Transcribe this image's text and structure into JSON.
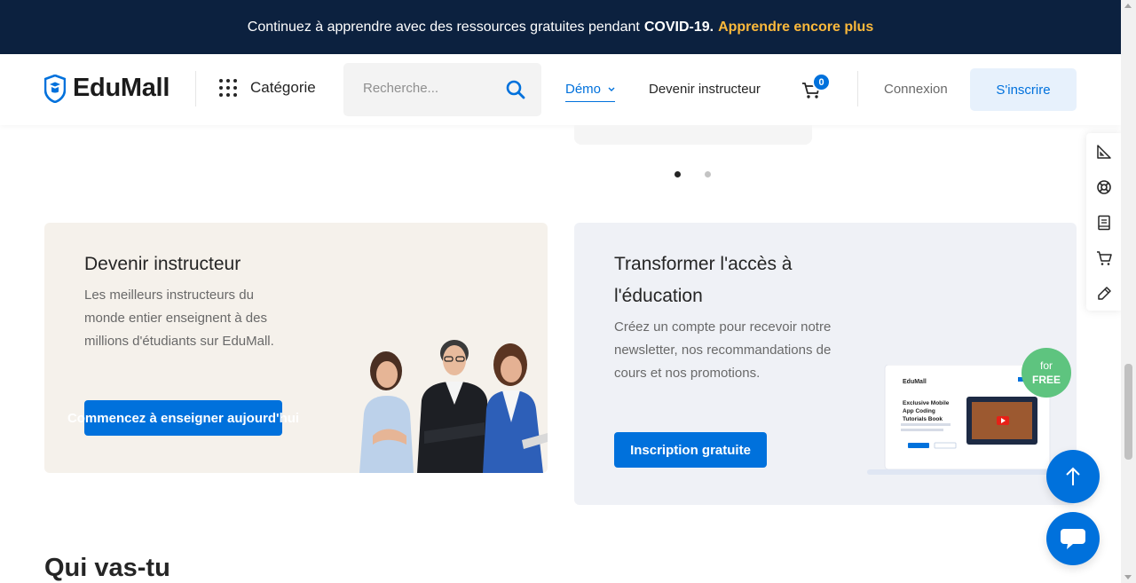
{
  "topbar": {
    "message": "Continuez à apprendre avec des ressources gratuites pendant",
    "highlight": "COVID-19.",
    "link": "Apprendre encore plus"
  },
  "header": {
    "logo": "EduMall",
    "category": "Catégorie",
    "search_placeholder": "Recherche...",
    "nav": {
      "demo": "Démo",
      "become_instructor": "Devenir instructeur"
    },
    "cart_count": "0",
    "login": "Connexion",
    "signup": "S'inscrire"
  },
  "carousel": {
    "slide_count": 2,
    "active_slide": 1
  },
  "card_instructor": {
    "title": "Devenir instructeur",
    "text": "Les meilleurs instructeurs du monde entier enseignent à des millions d'étudiants sur EduMall.",
    "button": "Commencez à enseigner aujourd'hui"
  },
  "card_access": {
    "title": "Transformer l'accès à l'éducation",
    "text": "Créez un compte pour recevoir notre newsletter, nos recommandations de cours et nos promotions.",
    "button": "Inscription gratuite",
    "badge_line1": "for",
    "badge_line2": "FREE",
    "mockup": {
      "logo": "EduMall",
      "heading": "Exclusive Mobile App Coding Tutorials Book"
    }
  },
  "section": {
    "title": "Qui vas-tu"
  },
  "colors": {
    "primary": "#0071dc",
    "topbar_bg": "#0c213f",
    "promo": "#fcb93b",
    "badge_green": "#5ec47f"
  },
  "icons": {
    "side_toolbar": [
      "ruler-icon",
      "lifebuoy-icon",
      "book-icon",
      "cart-icon",
      "pen-icon"
    ],
    "back_to_top": "arrow-up-icon",
    "chat": "chat-icon"
  }
}
